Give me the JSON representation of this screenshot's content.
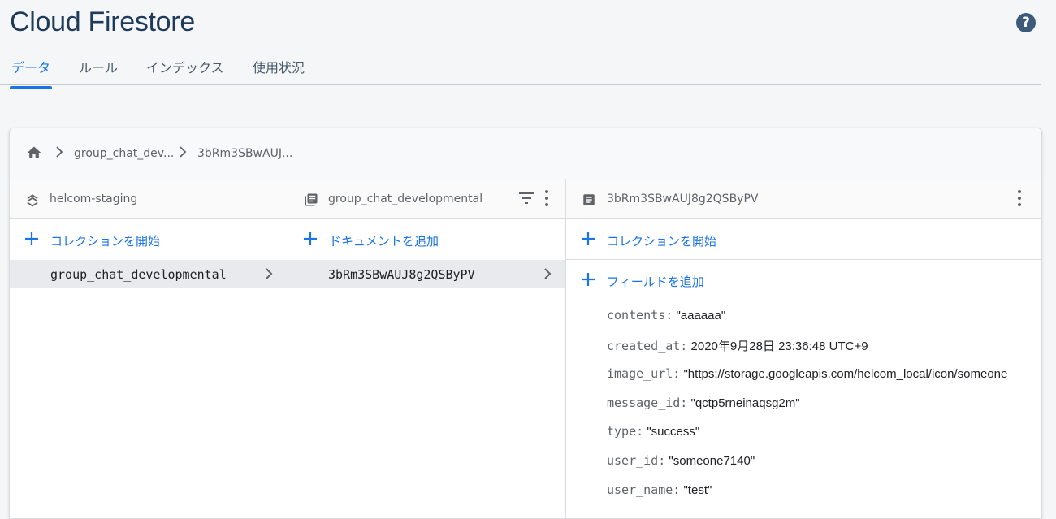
{
  "header": {
    "title": "Cloud Firestore"
  },
  "tabs": [
    {
      "label": "データ"
    },
    {
      "label": "ルール"
    },
    {
      "label": "インデックス"
    },
    {
      "label": "使用状況"
    }
  ],
  "breadcrumb": {
    "items": [
      "group_chat_dev...",
      "3bRm3SBwAUJ..."
    ]
  },
  "columns": {
    "root": {
      "title": "helcom-staging",
      "add_label": "コレクションを開始",
      "selected_item": "group_chat_developmental"
    },
    "collection": {
      "title": "group_chat_developmental",
      "add_label": "ドキュメントを追加",
      "selected_item": "3bRm3SBwAUJ8g2QSByPV"
    },
    "document": {
      "title": "3bRm3SBwAUJ8g2QSByPV",
      "add_collection_label": "コレクションを開始",
      "add_field_label": "フィールドを追加",
      "fields": [
        {
          "key": "contents:",
          "value": "\"aaaaaa\""
        },
        {
          "key": "created_at:",
          "value": "2020年9月28日 23:36:48 UTC+9"
        },
        {
          "key": "image_url:",
          "value": "\"https://storage.googleapis.com/helcom_local/icon/someone"
        },
        {
          "key": "message_id:",
          "value": "\"qctp5rneinaqsg2m\""
        },
        {
          "key": "type:",
          "value": "\"success\""
        },
        {
          "key": "user_id:",
          "value": "\"someone7140\""
        },
        {
          "key": "user_name:",
          "value": "\"test\""
        }
      ]
    }
  },
  "colors": {
    "accent": "#1a73e8",
    "title": "#1f3a5a"
  }
}
